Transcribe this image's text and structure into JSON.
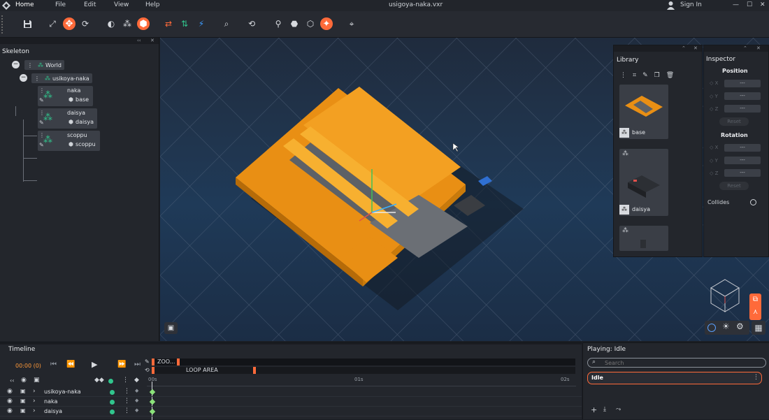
{
  "window": {
    "title": "usigoya-naka.vxr",
    "menu": [
      "Home",
      "File",
      "Edit",
      "View",
      "Help"
    ],
    "sign_in": "Sign In",
    "controls": [
      "—",
      "☐",
      "✕"
    ]
  },
  "toolbar": {
    "icons": [
      "save-icon",
      "fullscreen-icon",
      "move-icon",
      "rotate-icon",
      "world-icon",
      "hierarchy-icon",
      "cube-icon",
      "swap-icon",
      "align-icon",
      "bolt-icon",
      "search-icon",
      "refresh-icon",
      "tree-icon",
      "box-icon",
      "box-outline-icon",
      "add-icon",
      "target-icon"
    ]
  },
  "skeleton": {
    "title": "Skeleton",
    "world": "World",
    "root": "usikoya-naka",
    "children": [
      {
        "name": "naka",
        "part": "base"
      },
      {
        "name": "daisya",
        "part": "daisya"
      },
      {
        "name": "scoppu",
        "part": "scoppu"
      }
    ]
  },
  "library": {
    "title": "Library",
    "items": [
      "base",
      "daisya",
      ""
    ]
  },
  "inspector": {
    "title": "Inspector",
    "position_label": "Position",
    "rotation_label": "Rotation",
    "axes": [
      "X",
      "Y",
      "Z"
    ],
    "field_value": "---",
    "reset_label": "Reset",
    "collides_label": "Collides"
  },
  "timeline": {
    "title": "Timeline",
    "time": "00:00 (0)",
    "zoom_label": "ZOO...",
    "loop_label": "LOOP AREA",
    "ticks": [
      "00s",
      "01s",
      "02s"
    ],
    "tracks": [
      "usikoya-naka",
      "naka",
      "daisya"
    ]
  },
  "playing": {
    "title": "Playing: Idle",
    "search_placeholder": "Search",
    "animation": "Idle"
  },
  "colors": {
    "accent": "#ff6a3a",
    "green": "#31c58d",
    "panel": "#23262c"
  }
}
